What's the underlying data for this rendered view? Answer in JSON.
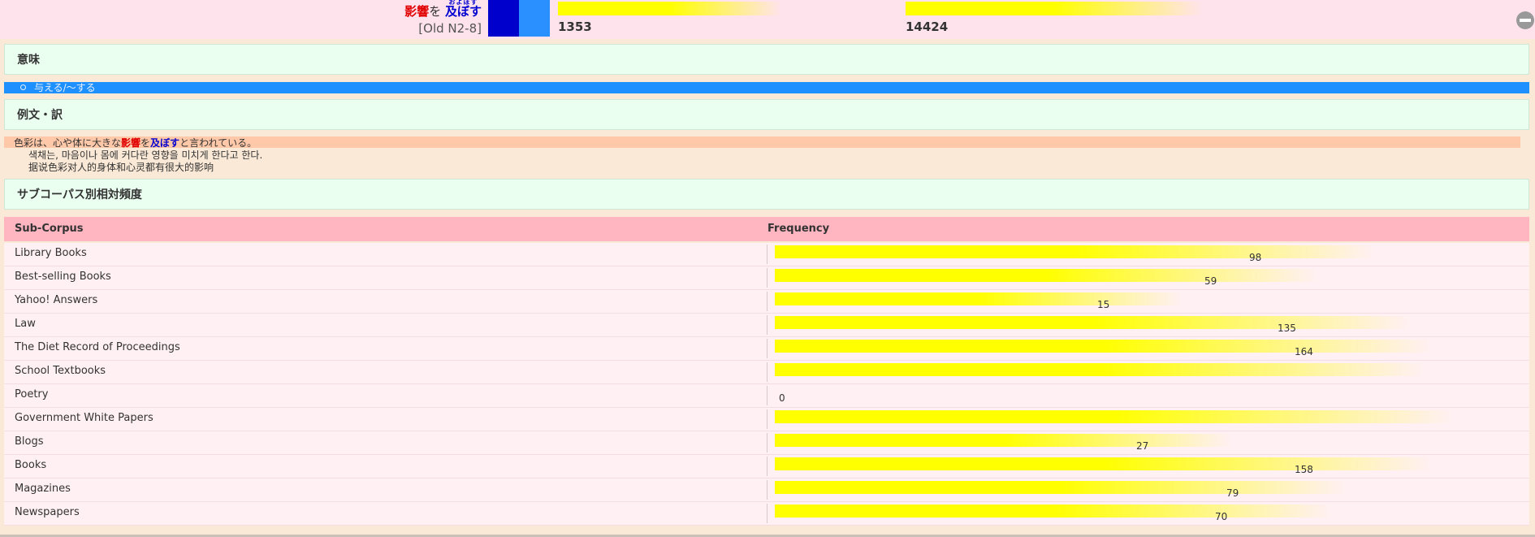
{
  "header": {
    "term": {
      "kanji_red": "影響",
      "particle": "を",
      "verb_blue": "及ぼす",
      "verb_ruby": "およぼす",
      "level": "[Old N2-8]"
    },
    "stat1": "1353",
    "stat2": "14424",
    "collapse_icon": "minus-circle-icon"
  },
  "sections": {
    "meaning_title": "意味",
    "meaning_item": "与える/〜する",
    "examples_title": "例文・訳",
    "subcorpus_title": "サブコーパス別相対頻度"
  },
  "example": {
    "jp_pre": "色彩は、心や体に大きな",
    "jp_red": "影響",
    "jp_mid": "を",
    "jp_blue": "及ぼす",
    "jp_post": "と言われている。",
    "ko": "색채는, 마음이나 몸에 커다란 영향을 미치게 한다고 한다.",
    "zh": "据说色彩对人的身体和心灵都有很大的影响"
  },
  "table": {
    "headers": [
      "Sub-Corpus",
      "Frequency"
    ],
    "max_value": 180,
    "rows": [
      {
        "name": "Library Books",
        "value": "98",
        "fill": 0.84
      },
      {
        "name": "Best-selling Books",
        "value": "59",
        "fill": 0.76
      },
      {
        "name": "Yahoo! Answers",
        "value": "15",
        "fill": 0.57
      },
      {
        "name": "Law",
        "value": "135",
        "fill": 0.89
      },
      {
        "name": "The Diet Record of Proceedings",
        "value": "164",
        "fill": 0.92
      },
      {
        "name": "School Textbooks",
        "value": "",
        "fill": 0.91
      },
      {
        "name": "Poetry",
        "value": "0",
        "fill": 0
      },
      {
        "name": "Government White Papers",
        "value": "",
        "fill": 0.95
      },
      {
        "name": "Blogs",
        "value": "27",
        "fill": 0.64
      },
      {
        "name": "Books",
        "value": "158",
        "fill": 0.92
      },
      {
        "name": "Magazines",
        "value": "79",
        "fill": 0.8
      },
      {
        "name": "Newspapers",
        "value": "70",
        "fill": 0.78
      }
    ]
  }
}
